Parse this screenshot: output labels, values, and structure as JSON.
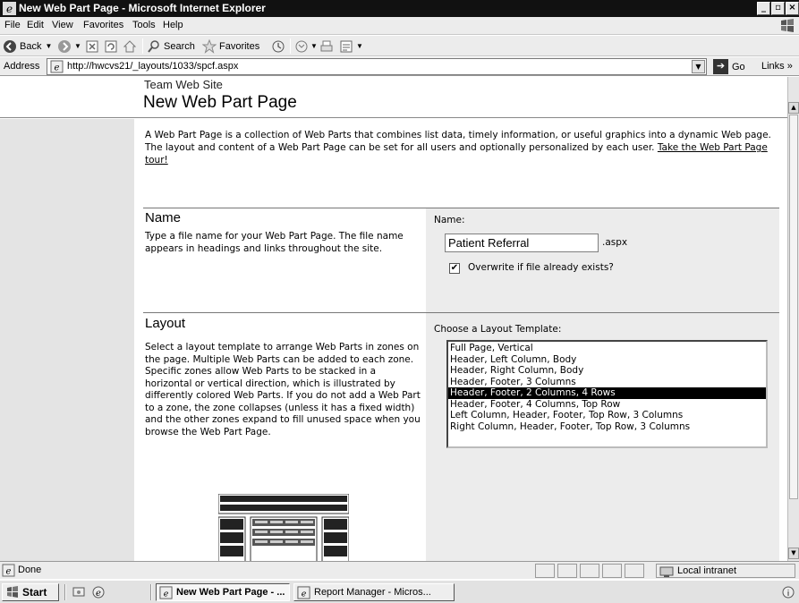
{
  "window": {
    "title": "New Web Part Page - Microsoft Internet Explorer",
    "buttons": [
      "_",
      "▫",
      "×"
    ]
  },
  "menu": [
    "File",
    "Edit",
    "View",
    "Favorites",
    "Tools",
    "Help"
  ],
  "toolbar": {
    "back": "Back",
    "search": "Search",
    "favorites": "Favorites"
  },
  "address": {
    "label": "Address",
    "url": "http://hwcvs21/_layouts/1033/spcf.aspx",
    "go": "Go",
    "links": "Links »"
  },
  "page": {
    "site_name": "Team Web Site",
    "title": "New Web Part Page",
    "intro": "A Web Part Page is a collection of Web Parts that combines list data, timely information, or useful graphics into a dynamic Web page. The layout and content of a Web Part Page can be set for all users and optionally personalized by each user.",
    "tour_link": "Take the Web Part Page tour!"
  },
  "name_section": {
    "title": "Name",
    "description": "Type a file name for your Web Part Page. The file name appears in headings and links throughout the site.",
    "field_label": "Name:",
    "value": "Patient Referral",
    "extension": ".aspx",
    "overwrite_label": "Overwrite if file already exists?",
    "overwrite_checked": true
  },
  "layout_section": {
    "title": "Layout",
    "description": "Select a layout template to arrange Web Parts in zones on the page. Multiple Web Parts can be added to each zone. Specific zones allow Web Parts to be stacked in a horizontal or vertical direction, which is illustrated by differently colored Web Parts. If you do not add a Web Part to a zone, the zone collapses (unless it has a fixed width) and the other zones expand to fill unused space when you browse the Web Part Page.",
    "field_label": "Choose a Layout Template:",
    "options": [
      "Full Page, Vertical",
      "Header, Left Column, Body",
      "Header, Right Column, Body",
      "Header, Footer, 3 Columns",
      "Header, Footer, 2 Columns, 4 Rows",
      "Header, Footer, 4 Columns, Top Row",
      "Left Column, Header, Footer, Top Row, 3 Columns",
      "Right Column, Header, Footer, Top Row, 3 Columns"
    ],
    "selected_index": 4
  },
  "status": {
    "text": "Done",
    "zone": "Local intranet"
  },
  "taskbar": {
    "start": "Start",
    "tasks": [
      "New Web Part Page - ...",
      "Report Manager - Micros..."
    ]
  }
}
